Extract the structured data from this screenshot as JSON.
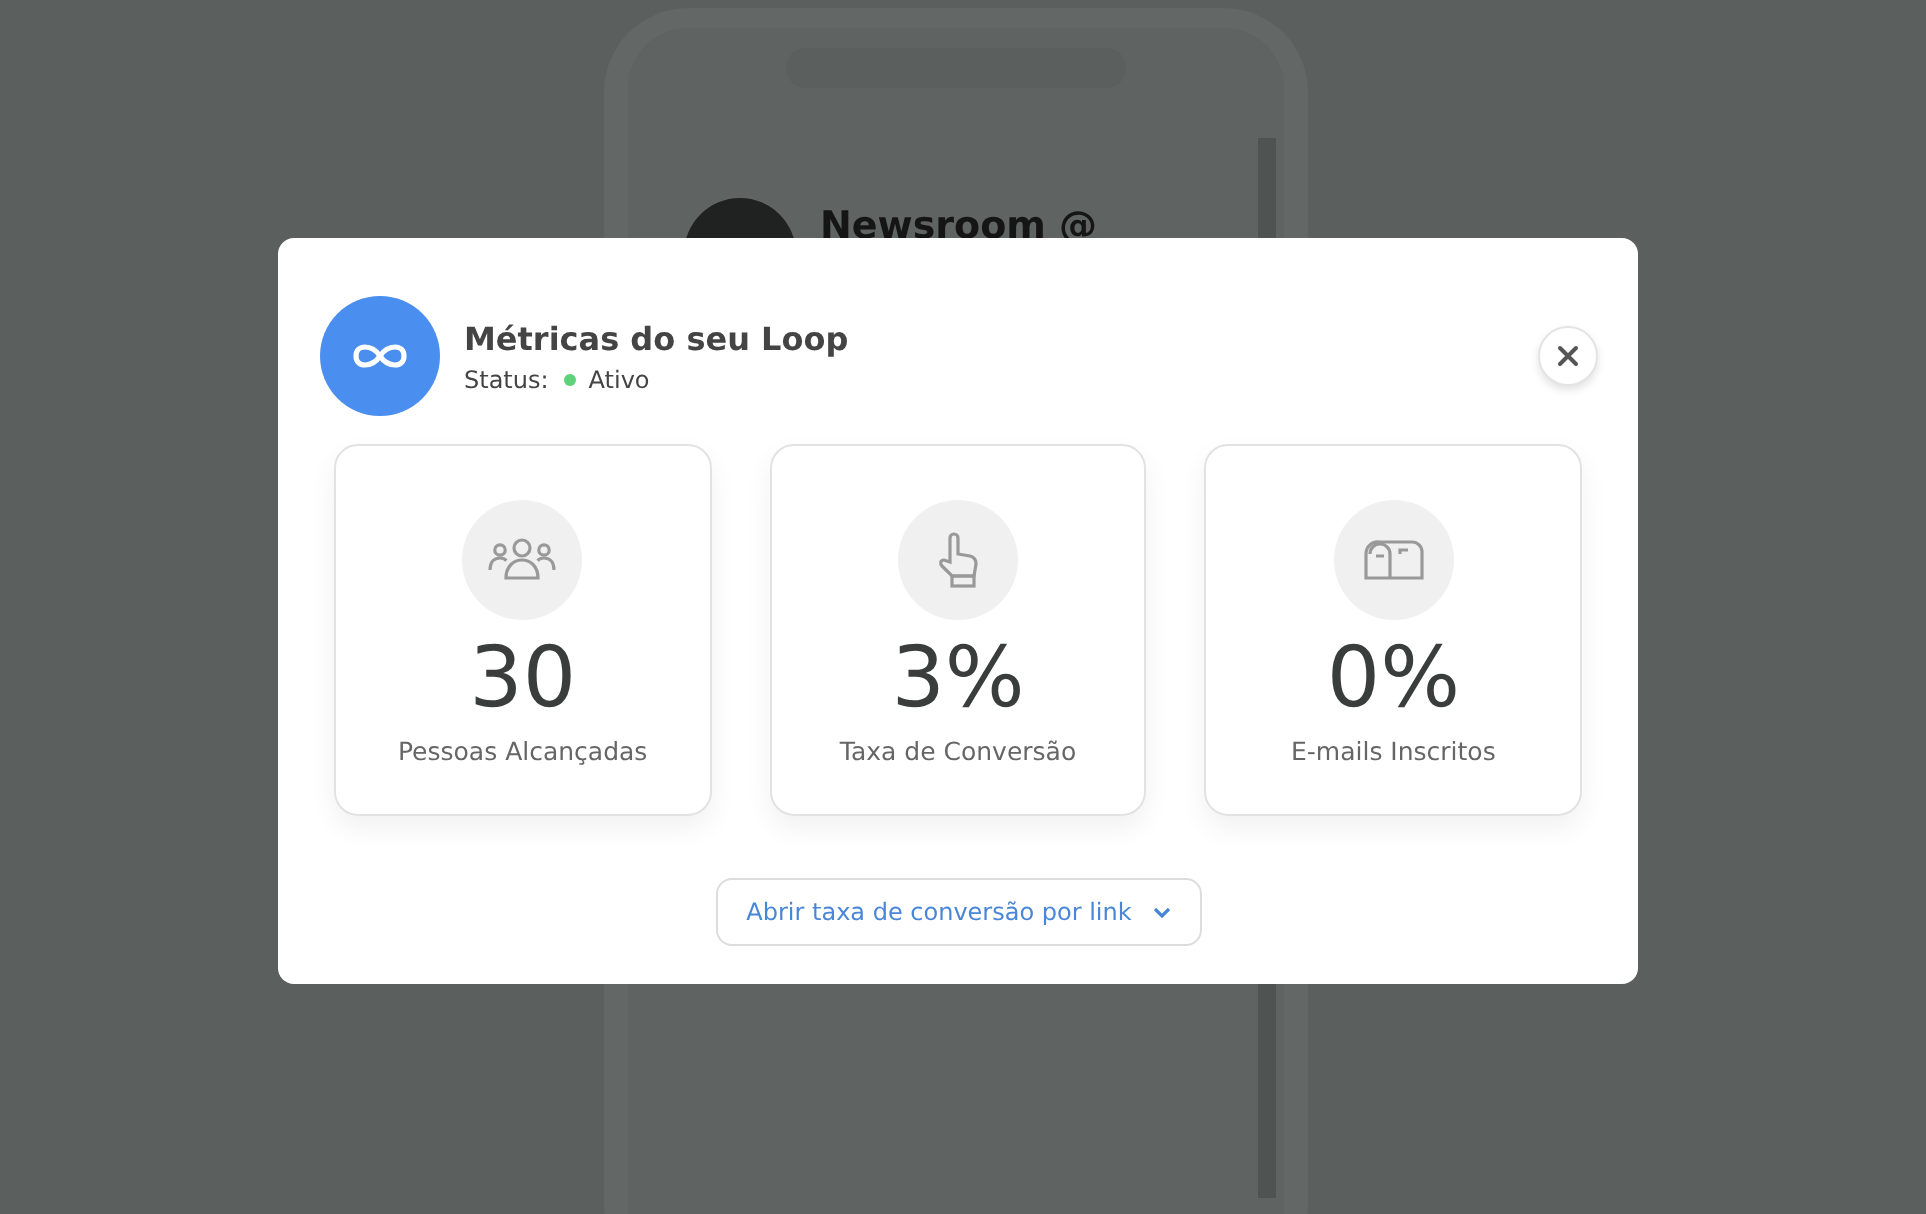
{
  "background": {
    "profile_name": "Newsroom @"
  },
  "modal": {
    "title": "Métricas do seu Loop",
    "status_label": "Status:",
    "status": {
      "label": "Ativo",
      "active": true
    },
    "metrics": [
      {
        "kind": "people",
        "value": "30",
        "label": "Pessoas Alcançadas"
      },
      {
        "kind": "hand",
        "value": "3%",
        "label": "Taxa de Conversão"
      },
      {
        "kind": "mailbox",
        "value": "0%",
        "label": "E-mails Inscritos"
      }
    ],
    "expand_button": "Abrir taxa de conversão por link"
  }
}
